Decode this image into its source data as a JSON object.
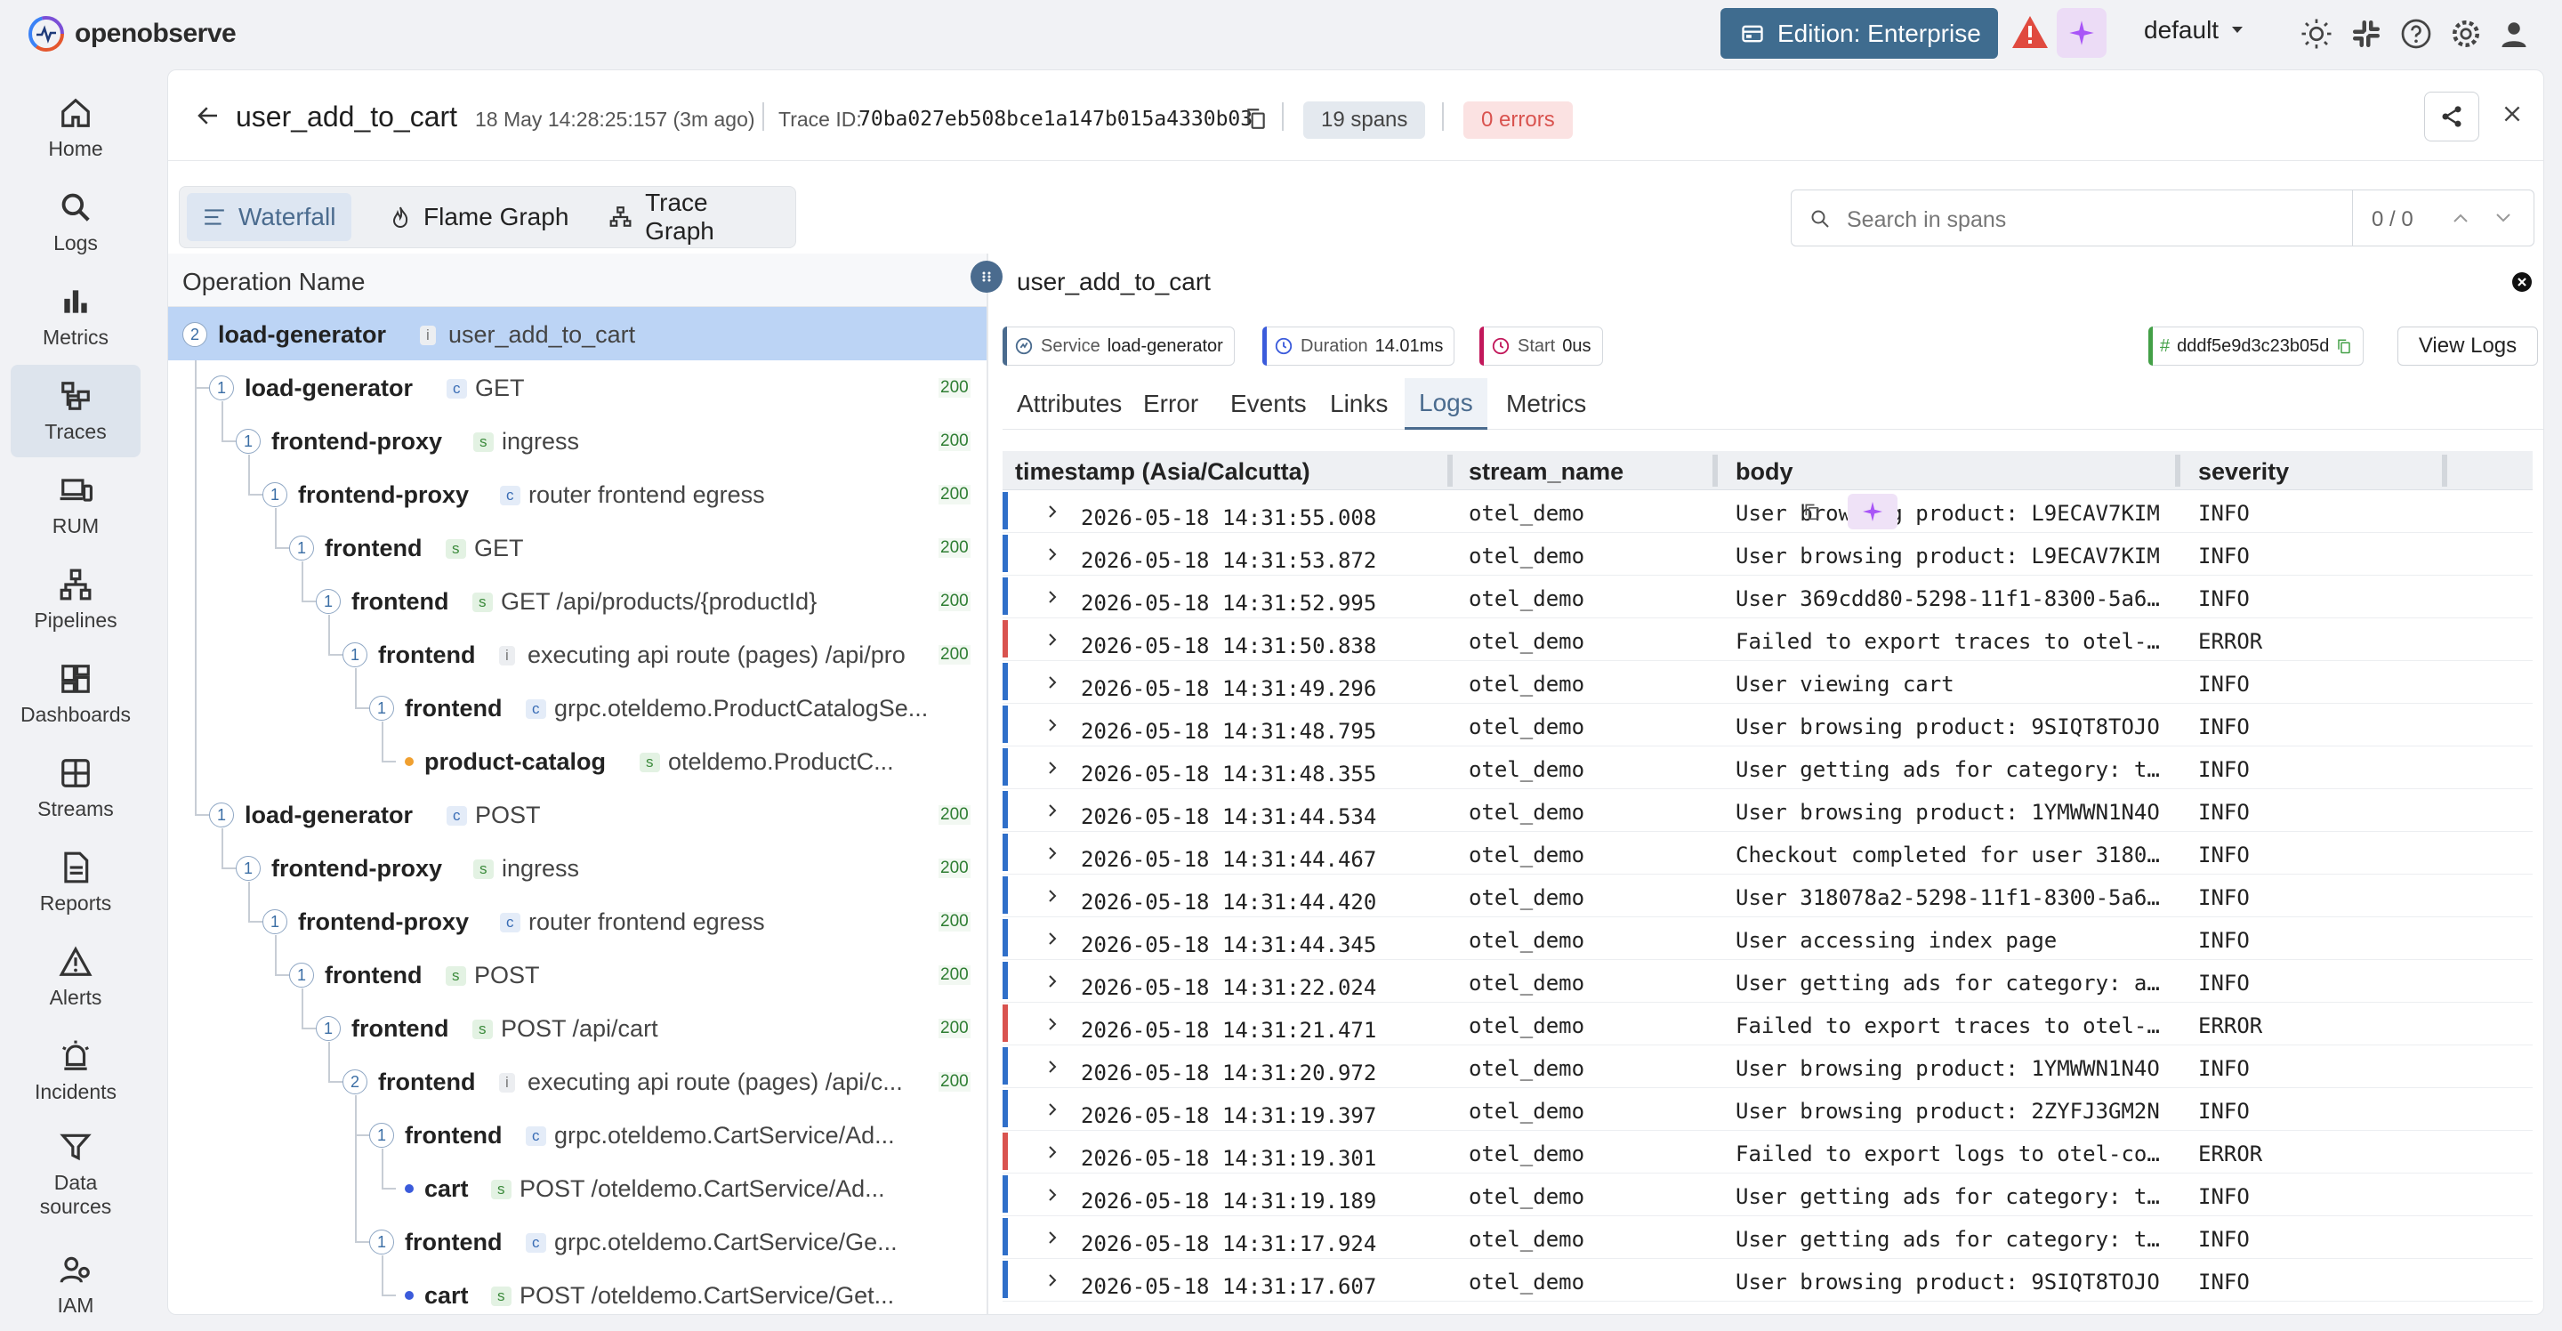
{
  "app": {
    "logo_text": "openobserve",
    "edition_label": "Edition: Enterprise",
    "org_selected": "default",
    "brand_color": "#3f6c8f"
  },
  "sidebar": {
    "items": [
      {
        "label": "Home",
        "icon": "home-icon"
      },
      {
        "label": "Logs",
        "icon": "search-icon"
      },
      {
        "label": "Metrics",
        "icon": "bar-chart-icon"
      },
      {
        "label": "Traces",
        "icon": "traces-icon",
        "active": true
      },
      {
        "label": "RUM",
        "icon": "devices-icon"
      },
      {
        "label": "Pipelines",
        "icon": "pipeline-icon"
      },
      {
        "label": "Dashboards",
        "icon": "dashboard-icon"
      },
      {
        "label": "Streams",
        "icon": "streams-icon"
      },
      {
        "label": "Reports",
        "icon": "report-icon"
      },
      {
        "label": "Alerts",
        "icon": "alert-icon"
      },
      {
        "label": "Incidents",
        "icon": "incident-icon"
      },
      {
        "label": "Data sources",
        "icon": "filter-icon"
      },
      {
        "label": "IAM",
        "icon": "iam-icon"
      }
    ]
  },
  "trace": {
    "title": "user_add_to_cart",
    "time": "18 May 14:28:25:157 (3m ago)",
    "trace_id_label": "Trace ID:",
    "trace_id": "70ba027eb508bce1a147b015a4330b03",
    "spans": "19 spans",
    "errors": "0 errors"
  },
  "view_tabs": [
    "Waterfall",
    "Flame Graph",
    "Trace Graph"
  ],
  "search": {
    "placeholder": "Search in spans",
    "count": "0 / 0"
  },
  "tree": {
    "header": "Operation Name",
    "rows": [
      {
        "depth": 0,
        "count": "2",
        "service": "load-generator",
        "kind": "I",
        "op": "user_add_to_cart",
        "status": "",
        "selected": true
      },
      {
        "depth": 1,
        "count": "1",
        "service": "load-generator",
        "kind": "C",
        "op": "GET",
        "status": "200"
      },
      {
        "depth": 2,
        "count": "1",
        "service": "frontend-proxy",
        "kind": "S",
        "op": "ingress",
        "status": "200"
      },
      {
        "depth": 3,
        "count": "1",
        "service": "frontend-proxy",
        "kind": "C",
        "op": "router frontend egress",
        "status": "200"
      },
      {
        "depth": 4,
        "count": "1",
        "service": "frontend",
        "kind": "S",
        "op": "GET",
        "status": "200"
      },
      {
        "depth": 5,
        "count": "1",
        "service": "frontend",
        "kind": "S",
        "op": "GET /api/products/{productId}",
        "status": "200"
      },
      {
        "depth": 6,
        "count": "1",
        "service": "frontend",
        "kind": "I",
        "op": "executing api route (pages) /api/pro",
        "status": "200"
      },
      {
        "depth": 7,
        "count": "1",
        "service": "frontend",
        "kind": "C",
        "op": "grpc.oteldemo.ProductCatalogSe...",
        "status": ""
      },
      {
        "depth": 8,
        "count": "",
        "service": "product-catalog",
        "kind": "S",
        "op": "oteldemo.ProductC...",
        "status": "",
        "dot": "#f0a030"
      },
      {
        "depth": 1,
        "count": "1",
        "service": "load-generator",
        "kind": "C",
        "op": "POST",
        "status": "200"
      },
      {
        "depth": 2,
        "count": "1",
        "service": "frontend-proxy",
        "kind": "S",
        "op": "ingress",
        "status": "200"
      },
      {
        "depth": 3,
        "count": "1",
        "service": "frontend-proxy",
        "kind": "C",
        "op": "router frontend egress",
        "status": "200"
      },
      {
        "depth": 4,
        "count": "1",
        "service": "frontend",
        "kind": "S",
        "op": "POST",
        "status": "200"
      },
      {
        "depth": 5,
        "count": "1",
        "service": "frontend",
        "kind": "S",
        "op": "POST /api/cart",
        "status": "200"
      },
      {
        "depth": 6,
        "count": "2",
        "service": "frontend",
        "kind": "I",
        "op": "executing api route (pages) /api/c...",
        "status": "200"
      },
      {
        "depth": 7,
        "count": "1",
        "service": "frontend",
        "kind": "C",
        "op": "grpc.oteldemo.CartService/Ad...",
        "status": ""
      },
      {
        "depth": 8,
        "count": "",
        "service": "cart",
        "kind": "S",
        "op": "POST /oteldemo.CartService/Ad...",
        "status": "",
        "dot": "#3b5bdb"
      },
      {
        "depth": 7,
        "count": "1",
        "service": "frontend",
        "kind": "C",
        "op": "grpc.oteldemo.CartService/Ge...",
        "status": ""
      },
      {
        "depth": 8,
        "count": "",
        "service": "cart",
        "kind": "S",
        "op": "POST /oteldemo.CartService/Get...",
        "status": "",
        "dot": "#3b5bdb"
      }
    ]
  },
  "detail": {
    "title": "user_add_to_cart",
    "service_label": "Service",
    "service": "load-generator",
    "duration_label": "Duration",
    "duration": "14.01ms",
    "start_label": "Start",
    "start": "0us",
    "span_id": "dddf5e9d3c23b05d",
    "view_logs": "View Logs",
    "tabs": [
      "Attributes",
      "Error",
      "Events",
      "Links",
      "Logs",
      "Metrics"
    ],
    "active_tab": "Logs"
  },
  "logs": {
    "columns": [
      "timestamp (Asia/Calcutta)",
      "stream_name",
      "body",
      "severity"
    ],
    "rows": [
      {
        "ts": "2026-05-18 14:31:55.008",
        "stream": "otel_demo",
        "body": "User browsing product: L9ECAV7KIM",
        "sev": "INFO"
      },
      {
        "ts": "2026-05-18 14:31:53.872",
        "stream": "otel_demo",
        "body": "User browsing product: L9ECAV7KIM",
        "sev": "INFO"
      },
      {
        "ts": "2026-05-18 14:31:52.995",
        "stream": "otel_demo",
        "body": "User 369cdd80-5298-11f1-8300-5a6…",
        "sev": "INFO"
      },
      {
        "ts": "2026-05-18 14:31:50.838",
        "stream": "otel_demo",
        "body": "Failed to export traces to otel-…",
        "sev": "ERROR"
      },
      {
        "ts": "2026-05-18 14:31:49.296",
        "stream": "otel_demo",
        "body": "User viewing cart",
        "sev": "INFO"
      },
      {
        "ts": "2026-05-18 14:31:48.795",
        "stream": "otel_demo",
        "body": "User browsing product: 9SIQT8TOJO",
        "sev": "INFO"
      },
      {
        "ts": "2026-05-18 14:31:48.355",
        "stream": "otel_demo",
        "body": "User getting ads for category: t…",
        "sev": "INFO"
      },
      {
        "ts": "2026-05-18 14:31:44.534",
        "stream": "otel_demo",
        "body": "User browsing product: 1YMWWN1N4O",
        "sev": "INFO"
      },
      {
        "ts": "2026-05-18 14:31:44.467",
        "stream": "otel_demo",
        "body": "Checkout completed for user 3180…",
        "sev": "INFO"
      },
      {
        "ts": "2026-05-18 14:31:44.420",
        "stream": "otel_demo",
        "body": "User 318078a2-5298-11f1-8300-5a6…",
        "sev": "INFO"
      },
      {
        "ts": "2026-05-18 14:31:44.345",
        "stream": "otel_demo",
        "body": "User accessing index page",
        "sev": "INFO"
      },
      {
        "ts": "2026-05-18 14:31:22.024",
        "stream": "otel_demo",
        "body": "User getting ads for category: a…",
        "sev": "INFO"
      },
      {
        "ts": "2026-05-18 14:31:21.471",
        "stream": "otel_demo",
        "body": "Failed to export traces to otel-…",
        "sev": "ERROR"
      },
      {
        "ts": "2026-05-18 14:31:20.972",
        "stream": "otel_demo",
        "body": "User browsing product: 1YMWWN1N4O",
        "sev": "INFO"
      },
      {
        "ts": "2026-05-18 14:31:19.397",
        "stream": "otel_demo",
        "body": "User browsing product: 2ZYFJ3GM2N",
        "sev": "INFO"
      },
      {
        "ts": "2026-05-18 14:31:19.301",
        "stream": "otel_demo",
        "body": "Failed to export logs to otel-co…",
        "sev": "ERROR"
      },
      {
        "ts": "2026-05-18 14:31:19.189",
        "stream": "otel_demo",
        "body": "User getting ads for category: t…",
        "sev": "INFO"
      },
      {
        "ts": "2026-05-18 14:31:17.924",
        "stream": "otel_demo",
        "body": "User getting ads for category: t…",
        "sev": "INFO"
      },
      {
        "ts": "2026-05-18 14:31:17.607",
        "stream": "otel_demo",
        "body": "User browsing product: 9SIQT8TOJO",
        "sev": "INFO"
      }
    ]
  }
}
